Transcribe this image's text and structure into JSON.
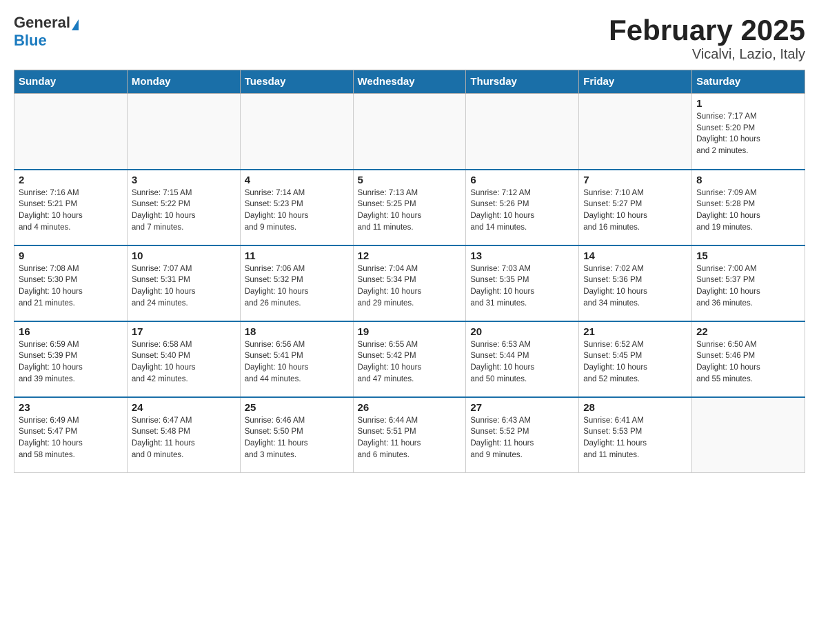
{
  "header": {
    "logo_general": "General",
    "logo_blue": "Blue",
    "title": "February 2025",
    "subtitle": "Vicalvi, Lazio, Italy"
  },
  "days_of_week": [
    "Sunday",
    "Monday",
    "Tuesday",
    "Wednesday",
    "Thursday",
    "Friday",
    "Saturday"
  ],
  "weeks": [
    [
      {
        "day": "",
        "info": ""
      },
      {
        "day": "",
        "info": ""
      },
      {
        "day": "",
        "info": ""
      },
      {
        "day": "",
        "info": ""
      },
      {
        "day": "",
        "info": ""
      },
      {
        "day": "",
        "info": ""
      },
      {
        "day": "1",
        "info": "Sunrise: 7:17 AM\nSunset: 5:20 PM\nDaylight: 10 hours\nand 2 minutes."
      }
    ],
    [
      {
        "day": "2",
        "info": "Sunrise: 7:16 AM\nSunset: 5:21 PM\nDaylight: 10 hours\nand 4 minutes."
      },
      {
        "day": "3",
        "info": "Sunrise: 7:15 AM\nSunset: 5:22 PM\nDaylight: 10 hours\nand 7 minutes."
      },
      {
        "day": "4",
        "info": "Sunrise: 7:14 AM\nSunset: 5:23 PM\nDaylight: 10 hours\nand 9 minutes."
      },
      {
        "day": "5",
        "info": "Sunrise: 7:13 AM\nSunset: 5:25 PM\nDaylight: 10 hours\nand 11 minutes."
      },
      {
        "day": "6",
        "info": "Sunrise: 7:12 AM\nSunset: 5:26 PM\nDaylight: 10 hours\nand 14 minutes."
      },
      {
        "day": "7",
        "info": "Sunrise: 7:10 AM\nSunset: 5:27 PM\nDaylight: 10 hours\nand 16 minutes."
      },
      {
        "day": "8",
        "info": "Sunrise: 7:09 AM\nSunset: 5:28 PM\nDaylight: 10 hours\nand 19 minutes."
      }
    ],
    [
      {
        "day": "9",
        "info": "Sunrise: 7:08 AM\nSunset: 5:30 PM\nDaylight: 10 hours\nand 21 minutes."
      },
      {
        "day": "10",
        "info": "Sunrise: 7:07 AM\nSunset: 5:31 PM\nDaylight: 10 hours\nand 24 minutes."
      },
      {
        "day": "11",
        "info": "Sunrise: 7:06 AM\nSunset: 5:32 PM\nDaylight: 10 hours\nand 26 minutes."
      },
      {
        "day": "12",
        "info": "Sunrise: 7:04 AM\nSunset: 5:34 PM\nDaylight: 10 hours\nand 29 minutes."
      },
      {
        "day": "13",
        "info": "Sunrise: 7:03 AM\nSunset: 5:35 PM\nDaylight: 10 hours\nand 31 minutes."
      },
      {
        "day": "14",
        "info": "Sunrise: 7:02 AM\nSunset: 5:36 PM\nDaylight: 10 hours\nand 34 minutes."
      },
      {
        "day": "15",
        "info": "Sunrise: 7:00 AM\nSunset: 5:37 PM\nDaylight: 10 hours\nand 36 minutes."
      }
    ],
    [
      {
        "day": "16",
        "info": "Sunrise: 6:59 AM\nSunset: 5:39 PM\nDaylight: 10 hours\nand 39 minutes."
      },
      {
        "day": "17",
        "info": "Sunrise: 6:58 AM\nSunset: 5:40 PM\nDaylight: 10 hours\nand 42 minutes."
      },
      {
        "day": "18",
        "info": "Sunrise: 6:56 AM\nSunset: 5:41 PM\nDaylight: 10 hours\nand 44 minutes."
      },
      {
        "day": "19",
        "info": "Sunrise: 6:55 AM\nSunset: 5:42 PM\nDaylight: 10 hours\nand 47 minutes."
      },
      {
        "day": "20",
        "info": "Sunrise: 6:53 AM\nSunset: 5:44 PM\nDaylight: 10 hours\nand 50 minutes."
      },
      {
        "day": "21",
        "info": "Sunrise: 6:52 AM\nSunset: 5:45 PM\nDaylight: 10 hours\nand 52 minutes."
      },
      {
        "day": "22",
        "info": "Sunrise: 6:50 AM\nSunset: 5:46 PM\nDaylight: 10 hours\nand 55 minutes."
      }
    ],
    [
      {
        "day": "23",
        "info": "Sunrise: 6:49 AM\nSunset: 5:47 PM\nDaylight: 10 hours\nand 58 minutes."
      },
      {
        "day": "24",
        "info": "Sunrise: 6:47 AM\nSunset: 5:48 PM\nDaylight: 11 hours\nand 0 minutes."
      },
      {
        "day": "25",
        "info": "Sunrise: 6:46 AM\nSunset: 5:50 PM\nDaylight: 11 hours\nand 3 minutes."
      },
      {
        "day": "26",
        "info": "Sunrise: 6:44 AM\nSunset: 5:51 PM\nDaylight: 11 hours\nand 6 minutes."
      },
      {
        "day": "27",
        "info": "Sunrise: 6:43 AM\nSunset: 5:52 PM\nDaylight: 11 hours\nand 9 minutes."
      },
      {
        "day": "28",
        "info": "Sunrise: 6:41 AM\nSunset: 5:53 PM\nDaylight: 11 hours\nand 11 minutes."
      },
      {
        "day": "",
        "info": ""
      }
    ]
  ]
}
